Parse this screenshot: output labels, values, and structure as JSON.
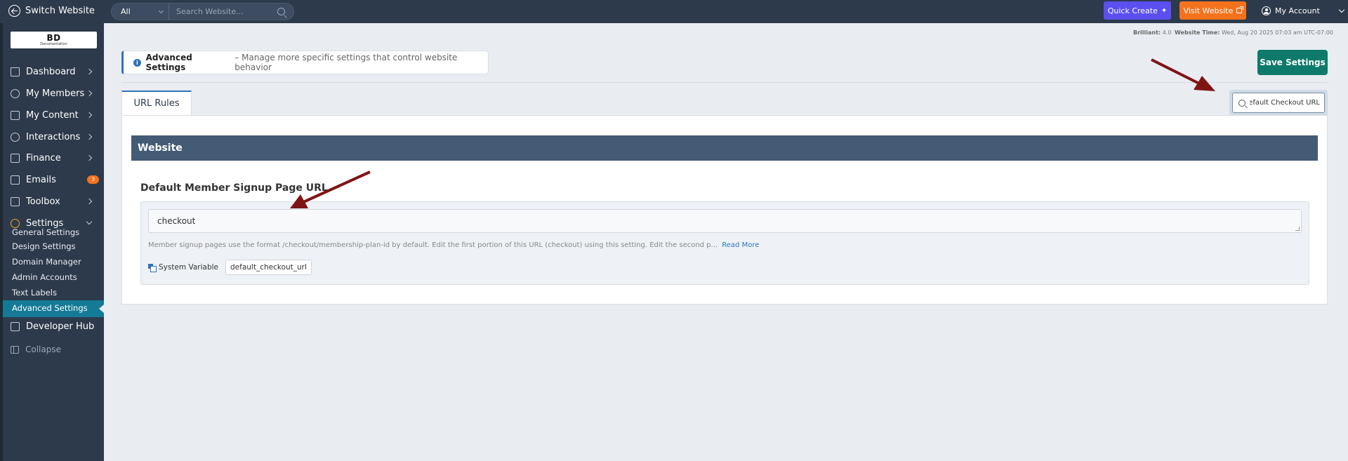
{
  "topbar": {
    "switch_label": "Switch Website",
    "search_scope": "All",
    "search_placeholder": "Search Website...",
    "quick_create": "Quick Create",
    "visit_website": "Visit Website",
    "account": "My Account"
  },
  "logo": {
    "main": "BD",
    "sub": "Documentation"
  },
  "sidebar": {
    "items": [
      {
        "label": "Dashboard",
        "icon": "house-icon"
      },
      {
        "label": "My Members",
        "icon": "users-icon"
      },
      {
        "label": "My Content",
        "icon": "folder-icon"
      },
      {
        "label": "Interactions",
        "icon": "chat-icon"
      },
      {
        "label": "Finance",
        "icon": "chart-icon"
      },
      {
        "label": "Emails",
        "icon": "mail-icon",
        "badge": "3"
      },
      {
        "label": "Toolbox",
        "icon": "tools-icon"
      },
      {
        "label": "Settings",
        "icon": "gear-icon"
      },
      {
        "label": "Developer Hub",
        "icon": "grid-icon"
      }
    ],
    "settings_sub": [
      "General Settings",
      "Design Settings",
      "Domain Manager",
      "Admin Accounts",
      "Text Labels",
      "Advanced Settings"
    ],
    "collapse": "Collapse"
  },
  "meta": {
    "version_label": "Brilliant:",
    "version": "4.0",
    "time_label": "Website Time:",
    "time": "Wed, Aug 20 2025 07:03 am UTC-07:00"
  },
  "header": {
    "title": "Advanced Settings",
    "description": "– Manage more specific settings that control website behavior",
    "save": "Save Settings"
  },
  "tabs": [
    "URL Rules"
  ],
  "filter": {
    "value": "Default Checkout URL"
  },
  "section": {
    "title": "Website",
    "field_label": "Default Member Signup Page URL",
    "field_value": "checkout",
    "help": "Member signup pages use the format /checkout/membership-plan-id by default. Edit the first portion of this URL (checkout) using this setting.  Edit the second p...",
    "read_more": "Read More",
    "sysvar_label": "System Variable",
    "sysvar_value": "default_checkout_url"
  },
  "colors": {
    "sidebar_bg": "#2d3a4b",
    "accent_blue": "#2f74b9",
    "save_green": "#0e7a6b",
    "quick_purple": "#5b4ff0",
    "visit_orange": "#f5721c",
    "section_bar": "#445b76",
    "arrow_red": "#7f1414"
  }
}
